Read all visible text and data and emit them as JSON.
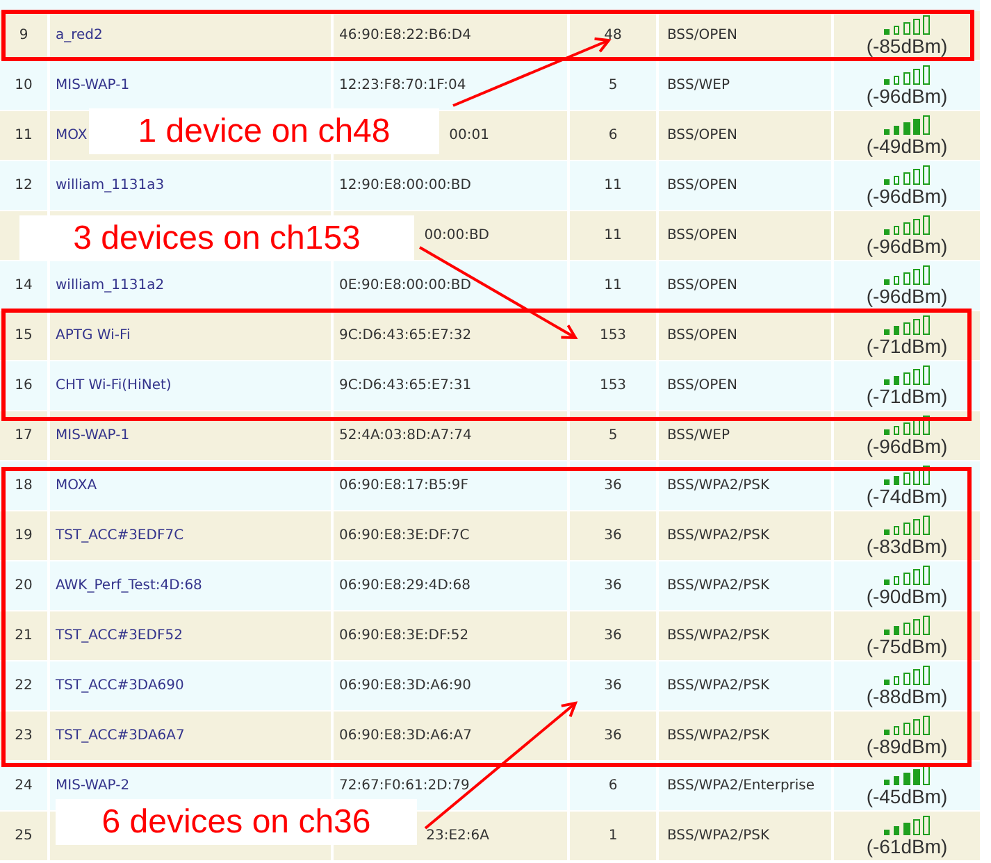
{
  "rows": [
    {
      "number": "9",
      "ssid": "a_red2",
      "mac": "46:90:E8:22:B6:D4",
      "channel": "48",
      "security": "BSS/OPEN",
      "signal": {
        "level": 0.2,
        "reading": "(-85dBm)"
      }
    },
    {
      "number": "10",
      "ssid": "MIS-WAP-1",
      "mac": "12:23:F8:70:1F:04",
      "channel": "5",
      "security": "BSS/WEP",
      "signal": {
        "level": 0.2,
        "reading": "(-96dBm)"
      }
    },
    {
      "number": "11",
      "ssid": "MOX",
      "mac": "00:01",
      "covered": true,
      "channel": "6",
      "security": "BSS/OPEN",
      "signal": {
        "level": 0.8,
        "reading": "(-49dBm)"
      }
    },
    {
      "number": "12",
      "ssid": "william_1131a3",
      "mac": "12:90:E8:00:00:BD",
      "channel": "11",
      "security": "BSS/OPEN",
      "signal": {
        "level": 0.2,
        "reading": "(-96dBm)"
      }
    },
    {
      "mac": "00:00:BD",
      "covered": true,
      "channel": "11",
      "security": "BSS/OPEN",
      "signal": {
        "level": 0.2,
        "reading": "(-96dBm)"
      }
    },
    {
      "number": "14",
      "ssid": "william_1131a2",
      "mac": "0E:90:E8:00:00:BD",
      "channel": "11",
      "security": "BSS/OPEN",
      "signal": {
        "level": 0.2,
        "reading": "(-96dBm)"
      }
    },
    {
      "number": "15",
      "ssid": "APTG Wi-Fi",
      "mac": "9C:D6:43:65:E7:32",
      "channel": "153",
      "security": "BSS/OPEN",
      "signal": {
        "level": 0.4,
        "reading": "(-71dBm)"
      }
    },
    {
      "number": "16",
      "ssid": "CHT Wi-Fi(HiNet)",
      "mac": "9C:D6:43:65:E7:31",
      "channel": "153",
      "security": "BSS/OPEN",
      "signal": {
        "level": 0.4,
        "reading": "(-71dBm)"
      }
    },
    {
      "number": "17",
      "ssid": "MIS-WAP-1",
      "mac": "52:4A:03:8D:A7:74",
      "channel": "5",
      "security": "BSS/WEP",
      "signal": {
        "level": 0.2,
        "reading": "(-96dBm)"
      }
    },
    {
      "number": "18",
      "ssid": "MOXA",
      "mac": "06:90:E8:17:B5:9F",
      "channel": "36",
      "security": "BSS/WPA2/PSK",
      "signal": {
        "level": 0.4,
        "reading": "(-74dBm)"
      }
    },
    {
      "number": "19",
      "ssid": "TST_ACC#3EDF7C",
      "mac": "06:90:E8:3E:DF:7C",
      "channel": "36",
      "security": "BSS/WPA2/PSK",
      "signal": {
        "level": 0.2,
        "reading": "(-83dBm)"
      }
    },
    {
      "number": "20",
      "ssid": "AWK_Perf_Test:4D:68",
      "mac": "06:90:E8:29:4D:68",
      "channel": "36",
      "security": "BSS/WPA2/PSK",
      "signal": {
        "level": 0.2,
        "reading": "(-90dBm)"
      }
    },
    {
      "number": "21",
      "ssid": "TST_ACC#3EDF52",
      "mac": "06:90:E8:3E:DF:52",
      "channel": "36",
      "security": "BSS/WPA2/PSK",
      "signal": {
        "level": 0.4,
        "reading": "(-75dBm)"
      }
    },
    {
      "number": "22",
      "ssid": "TST_ACC#3DA690",
      "mac": "06:90:E8:3D:A6:90",
      "channel": "36",
      "security": "BSS/WPA2/PSK",
      "signal": {
        "level": 0.2,
        "reading": "(-88dBm)"
      }
    },
    {
      "number": "23",
      "ssid": "TST_ACC#3DA6A7",
      "mac": "06:90:E8:3D:A6:A7",
      "channel": "36",
      "security": "BSS/WPA2/PSK",
      "signal": {
        "level": 0.2,
        "reading": "(-89dBm)"
      }
    },
    {
      "number": "24",
      "ssid": "MIS-WAP-2",
      "mac": "72:67:F0:61:2D:79",
      "channel": "6",
      "security": "BSS/WPA2/Enterprise",
      "signal": {
        "level": 0.8,
        "reading": "(-45dBm)"
      }
    },
    {
      "number": "25",
      "mac": "23:E2:6A",
      "covered": true,
      "channel": "1",
      "security": "BSS/WPA2/PSK",
      "signal": {
        "level": 0.6,
        "reading": "(-61dBm)"
      }
    }
  ],
  "callouts": [
    {
      "text": "1 device on ch48"
    },
    {
      "text": "3 devices on ch153"
    },
    {
      "text": "6 devices on ch36"
    }
  ]
}
